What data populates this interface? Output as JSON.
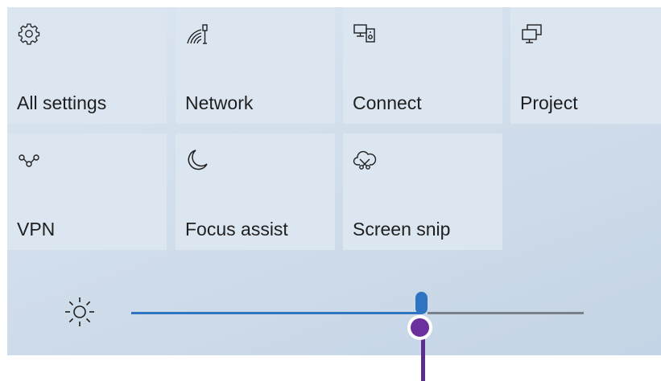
{
  "quick_actions": [
    {
      "label": "All settings",
      "icon": "gear-icon"
    },
    {
      "label": "Network",
      "icon": "network-icon"
    },
    {
      "label": "Connect",
      "icon": "connect-icon"
    },
    {
      "label": "Project",
      "icon": "project-icon"
    },
    {
      "label": "VPN",
      "icon": "vpn-icon"
    },
    {
      "label": "Focus assist",
      "icon": "moon-icon"
    },
    {
      "label": "Screen snip",
      "icon": "screen-snip-icon"
    }
  ],
  "brightness": {
    "icon": "sun-icon",
    "level_fraction": 0.64
  },
  "colors": {
    "accent": "#2f74c0",
    "callout": "#6b2f9e"
  }
}
